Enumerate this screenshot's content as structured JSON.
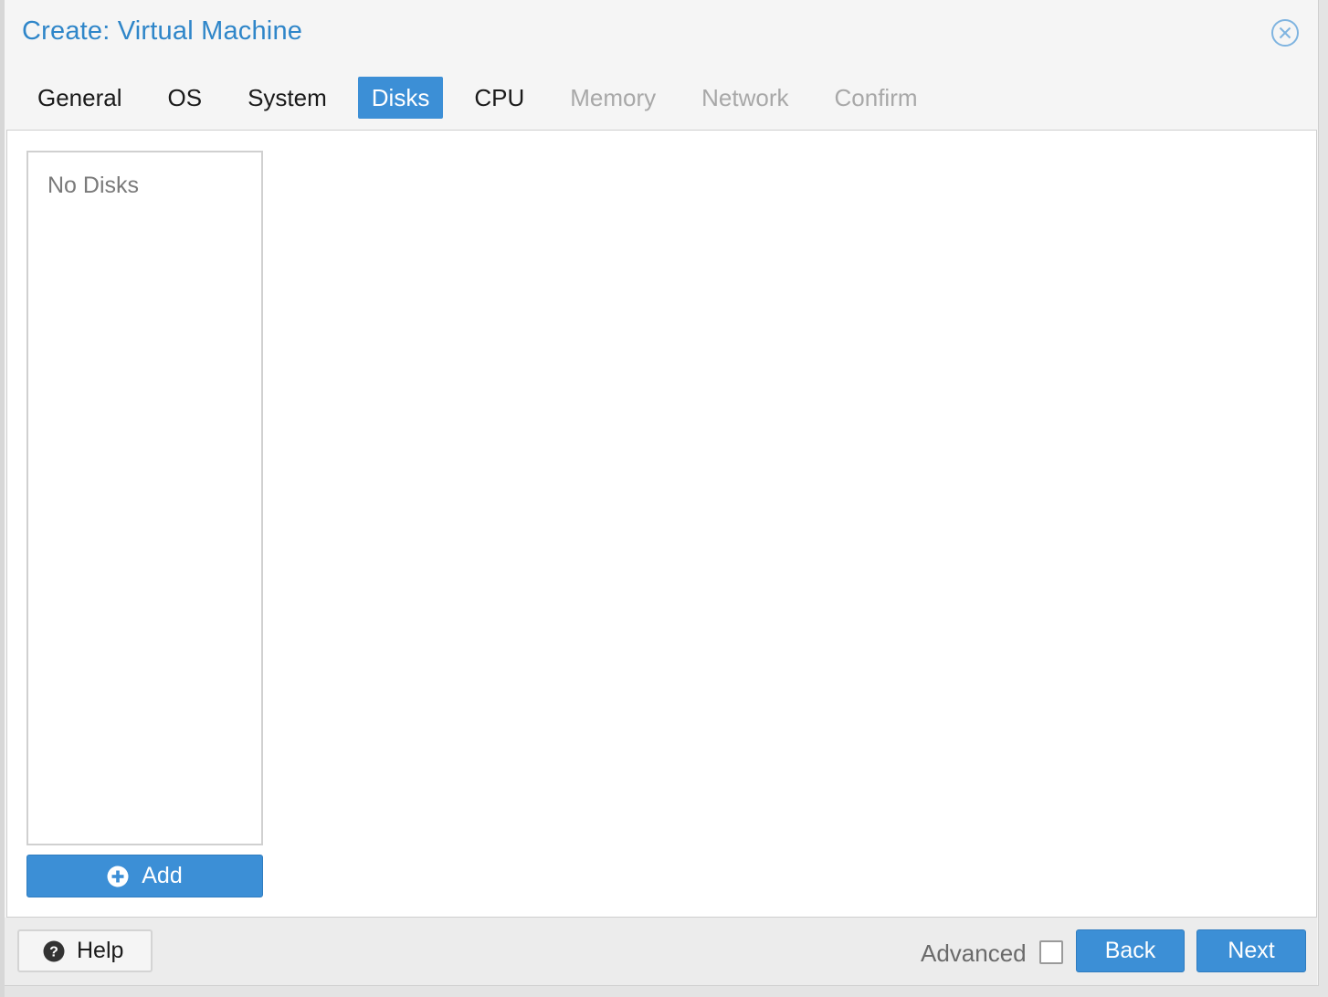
{
  "dialog": {
    "title": "Create: Virtual Machine"
  },
  "tabs": [
    {
      "label": "General",
      "state": "enabled"
    },
    {
      "label": "OS",
      "state": "enabled"
    },
    {
      "label": "System",
      "state": "enabled"
    },
    {
      "label": "Disks",
      "state": "active"
    },
    {
      "label": "CPU",
      "state": "enabled"
    },
    {
      "label": "Memory",
      "state": "disabled"
    },
    {
      "label": "Network",
      "state": "disabled"
    },
    {
      "label": "Confirm",
      "state": "disabled"
    }
  ],
  "disks": {
    "empty_text": "No Disks",
    "add_label": "Add",
    "add_icon": "plus-circle-icon"
  },
  "footer": {
    "help_label": "Help",
    "help_icon": "question-circle-icon",
    "advanced_label": "Advanced",
    "advanced_checked": false,
    "back_label": "Back",
    "next_label": "Next"
  },
  "colors": {
    "accent": "#3c8fd6",
    "title": "#2f86c9",
    "disabled_text": "#a8a8a8"
  }
}
